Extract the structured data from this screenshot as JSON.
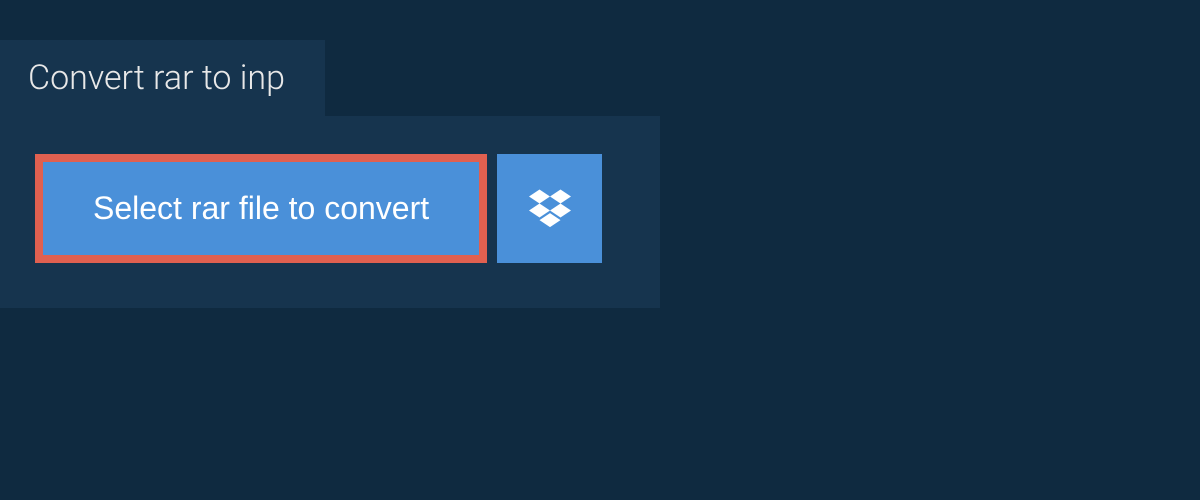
{
  "tab": {
    "title": "Convert rar to inp"
  },
  "panel": {
    "select_file_label": "Select rar file to convert",
    "dropbox_icon": "dropbox"
  },
  "colors": {
    "background": "#0f2a40",
    "panel": "#16344e",
    "button": "#4a90d9",
    "button_border": "#e06050",
    "text_light": "#e8e8e8"
  }
}
